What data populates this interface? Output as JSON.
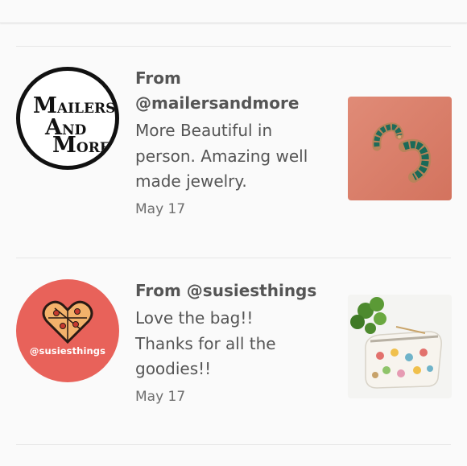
{
  "reviews": [
    {
      "from_prefix": "From",
      "username": "@mailersandmore",
      "comment_lines": [
        "More Beautiful in",
        "person. Amazing well",
        "made jewelry."
      ],
      "date": "May 17",
      "avatar": {
        "logo_lines": [
          {
            "big": "M",
            "small": "AILERS"
          },
          {
            "big": "A",
            "small": "ND"
          },
          {
            "big": "M",
            "small": "ORE"
          }
        ]
      },
      "thumbnail": "green-baguette-hoop-earrings"
    },
    {
      "from_prefix": "From",
      "username": "@susiesthings",
      "comment_lines": [
        "Love the bag!!",
        "Thanks for all the",
        "goodies!!"
      ],
      "date": "May 17",
      "avatar": {
        "label": "@susiesthings",
        "color": "#e8625a"
      },
      "thumbnail": "patterned-zipper-pouch-with-plant"
    }
  ]
}
